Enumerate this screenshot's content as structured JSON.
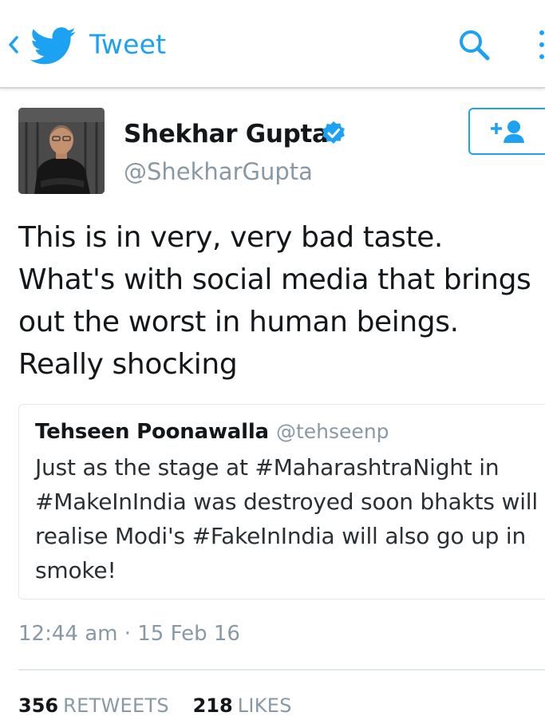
{
  "header": {
    "title": "Tweet",
    "back_icon": "chevron-left-icon",
    "logo_icon": "twitter-bird-icon",
    "search_icon": "search-icon",
    "more_icon": "more-vertical-icon",
    "accent_color": "#1da1f2"
  },
  "tweet": {
    "author_name": "Shekhar Gupta",
    "author_handle": "@ShekharGupta",
    "verified": true,
    "follow_icon": "add-user-icon",
    "text": "This is in very, very bad taste. What's with social media that brings out the worst in human beings. Really shocking",
    "timestamp": "12:44 am · 15 Feb 16"
  },
  "quoted_tweet": {
    "author_name": "Tehseen Poonawalla",
    "author_handle": "@tehseenp",
    "text": "Just as the stage at #MaharashtraNight in #MakeInIndia was destroyed soon bhakts will realise Modi's #FakeInIndia will also go up in smoke!"
  },
  "stats": {
    "retweets_count": "356",
    "retweets_label": "RETWEETS",
    "likes_count": "218",
    "likes_label": "LIKES"
  }
}
